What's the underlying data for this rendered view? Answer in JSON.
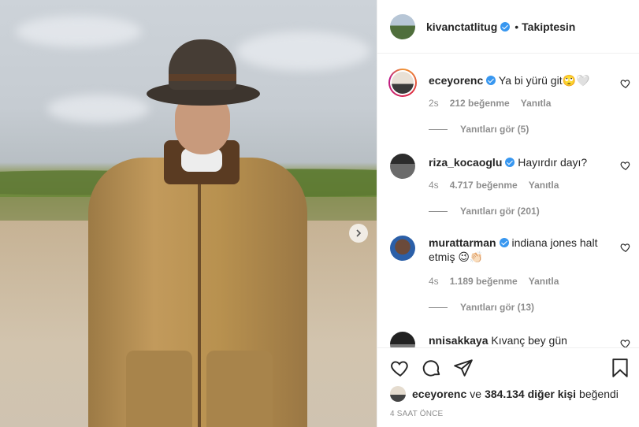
{
  "header": {
    "username": "kivanctatlitug",
    "separator": "•",
    "follow_status": "Takiptesin"
  },
  "comments": [
    {
      "username": "eceyorenc",
      "text": "Ya bi yürü git🙄🤍",
      "age": "2s",
      "likes": "212 beğenme",
      "reply": "Yanıtla",
      "view_replies": "Yanıtları gör (5)",
      "story_ring": true
    },
    {
      "username": "riza_kocaoglu",
      "text": "Hayırdır dayı?",
      "age": "4s",
      "likes": "4.717 beğenme",
      "reply": "Yanıtla",
      "view_replies": "Yanıtları gör (201)"
    },
    {
      "username": "murattarman",
      "text": "indiana jones halt etmiş 😉👏🏻",
      "age": "4s",
      "likes": "1.189 beğenme",
      "reply": "Yanıtla",
      "view_replies": "Yanıtları gör (13)"
    },
    {
      "username": "nnisakkaya",
      "text": "Kıvanç bey gün"
    }
  ],
  "liked_by": {
    "user": "eceyorenc",
    "connector": "ve",
    "others": "384.134 diğer kişi",
    "suffix": "beğendi"
  },
  "time_ago": "4 SAAT ÖNCE",
  "icons": {
    "like": "heart-icon",
    "comment": "comment-icon",
    "share": "send-icon",
    "save": "bookmark-icon",
    "next": "chevron-right-icon",
    "verified": "verified-badge-icon"
  },
  "colors": {
    "verified": "#3897f0",
    "text": "#262626",
    "secondary": "#8e8e8e",
    "border": "#efefef"
  }
}
